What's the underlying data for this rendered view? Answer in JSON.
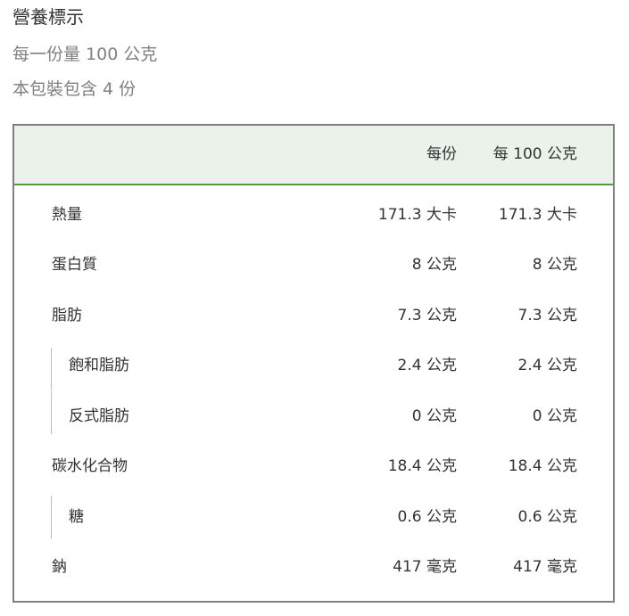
{
  "header": {
    "title": "營養標示",
    "serving_size": "每一份量 100 公克",
    "servings_per_package": "本包裝包含 4 份"
  },
  "table": {
    "columns": [
      "每份",
      "每 100 公克"
    ],
    "rows": [
      {
        "name": "熱量",
        "level": 0,
        "per_serving": "171.3 大卡",
        "per_100g": "171.3 大卡"
      },
      {
        "name": "蛋白質",
        "level": 0,
        "per_serving": "8 公克",
        "per_100g": "8 公克"
      },
      {
        "name": "脂肪",
        "level": 0,
        "per_serving": "7.3 公克",
        "per_100g": "7.3 公克"
      },
      {
        "name": "飽和脂肪",
        "level": 1,
        "per_serving": "2.4 公克",
        "per_100g": "2.4 公克"
      },
      {
        "name": "反式脂肪",
        "level": 1,
        "per_serving": "0 公克",
        "per_100g": "0 公克"
      },
      {
        "name": "碳水化合物",
        "level": 0,
        "per_serving": "18.4 公克",
        "per_100g": "18.4 公克"
      },
      {
        "name": "糖",
        "level": 1,
        "per_serving": "0.6 公克",
        "per_100g": "0.6 公克"
      },
      {
        "name": "鈉",
        "level": 0,
        "per_serving": "417 毫克",
        "per_100g": "417 毫克"
      }
    ]
  },
  "colors": {
    "header_bg": "#eaf2ea",
    "header_rule": "#4e9a3e",
    "border": "#808080",
    "muted_text": "#808080"
  }
}
